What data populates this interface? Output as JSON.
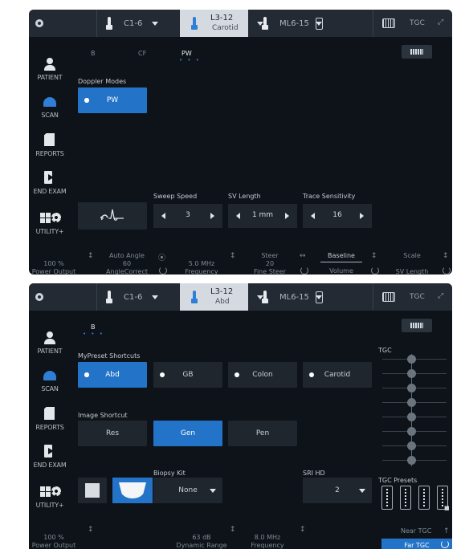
{
  "screen1": {
    "topbar": {
      "probes": [
        {
          "label": "C1-6"
        },
        {
          "label": "L3-12",
          "sublabel": "Carotid"
        },
        {
          "label": "ML6-15"
        }
      ],
      "tgc_label": "TGC"
    },
    "sidebar": [
      {
        "label": "PATIENT"
      },
      {
        "label": "SCAN"
      },
      {
        "label": "REPORTS"
      },
      {
        "label": "END EXAM"
      },
      {
        "label": "UTILITY+"
      }
    ],
    "tabs": [
      {
        "label": "B"
      },
      {
        "label": "CF"
      },
      {
        "label": "PW"
      }
    ],
    "tab_dots": "• • •",
    "doppler_modes": {
      "title": "Doppler Modes",
      "button": "PW"
    },
    "sweep_speed": {
      "title": "Sweep Speed",
      "value": "3"
    },
    "sv_length": {
      "title": "SV Length",
      "value": "1 mm"
    },
    "trace_sensitivity": {
      "title": "Trace Sensitivity",
      "value": "16"
    },
    "bottom": [
      {
        "value": "100 %",
        "label": "Power Output"
      },
      {
        "value": "Auto Angle",
        "value2": "60",
        "label": "AngleCorrect"
      },
      {
        "value": "5.0 MHz",
        "label": "Frequency"
      },
      {
        "value": "Steer",
        "value2": "20",
        "label": "Fine Steer"
      },
      {
        "value": "Baseline",
        "label": "Volume"
      },
      {
        "value": "Scale",
        "label": "SV Length"
      }
    ]
  },
  "screen2": {
    "topbar": {
      "probes": [
        {
          "label": "C1-6"
        },
        {
          "label": "L3-12",
          "sublabel": "Abd"
        },
        {
          "label": "ML6-15"
        }
      ],
      "tgc_label": "TGC"
    },
    "sidebar": [
      {
        "label": "PATIENT"
      },
      {
        "label": "SCAN"
      },
      {
        "label": "REPORTS"
      },
      {
        "label": "END EXAM"
      },
      {
        "label": "UTILITY+"
      }
    ],
    "tab": "B",
    "tab_dots": "• • •",
    "mypreset": {
      "title": "MyPreset Shortcuts",
      "buttons": [
        "Abd",
        "GB",
        "Colon",
        "Carotid"
      ]
    },
    "image_shortcut": {
      "title": "Image Shortcut",
      "buttons": [
        "Res",
        "Gen",
        "Pen"
      ]
    },
    "biopsy_kit": {
      "title": "Biopsy Kit",
      "value": "None"
    },
    "sri_hd": {
      "title": "SRI HD",
      "value": "2"
    },
    "tgc": {
      "title": "TGC",
      "presets_title": "TGC Presets",
      "near": "Near TGC",
      "far": "Far TGC"
    },
    "bottom": [
      {
        "value": "100 %",
        "label": "Power Output"
      },
      {
        "value": "63 dB",
        "label": "Dynamic Range"
      },
      {
        "value": "8.0 MHz",
        "label": "Frequency"
      }
    ]
  },
  "colors": {
    "accent": "#2373c8",
    "panel_bg": "#0e1319",
    "topbar_bg": "#232a33"
  }
}
